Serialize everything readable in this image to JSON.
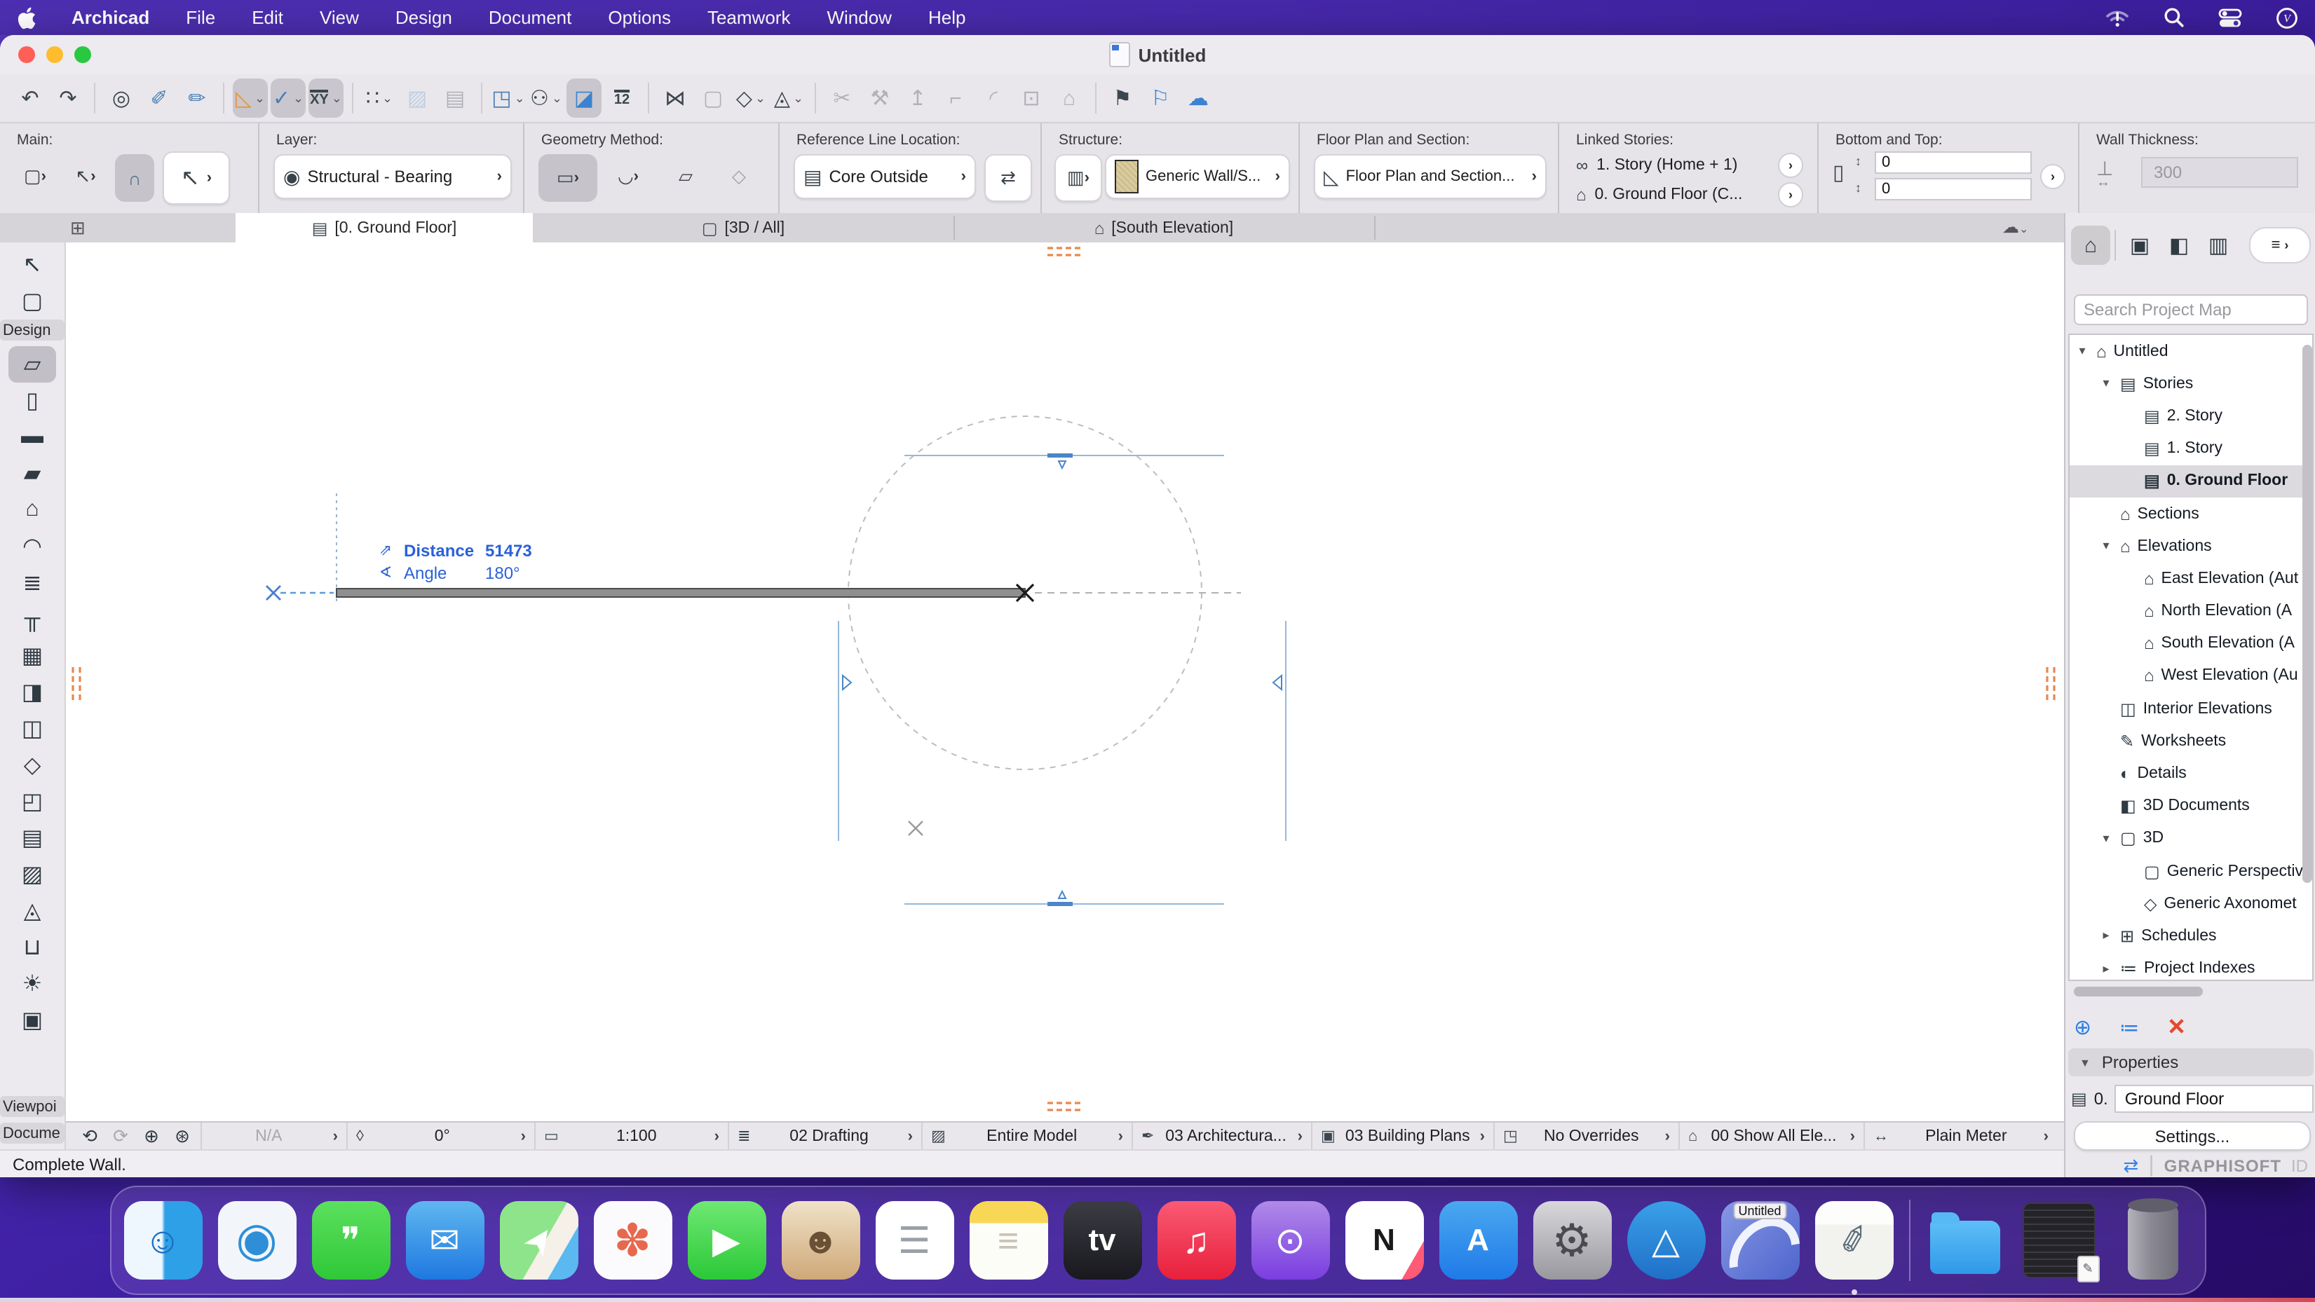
{
  "menu_bar": {
    "app_name": "Archicad",
    "items": [
      "File",
      "Edit",
      "View",
      "Design",
      "Document",
      "Options",
      "Teamwork",
      "Window",
      "Help"
    ],
    "status_icons": [
      "wifi-alert-icon",
      "search-icon",
      "control-center-icon",
      "clock-icon"
    ]
  },
  "window": {
    "title": "Untitled"
  },
  "toolbar": {
    "buttons": [
      {
        "name": "undo-button",
        "glyph": "↶"
      },
      {
        "name": "redo-button",
        "glyph": "↷"
      },
      {
        "divider": true
      },
      {
        "name": "find-select-button",
        "glyph": "◎"
      },
      {
        "name": "pick-up-parameters-button",
        "glyph": "✐",
        "color": "#4a7fb5"
      },
      {
        "name": "inject-parameters-button",
        "glyph": "✏",
        "color": "#4a7fb5"
      },
      {
        "divider": true
      },
      {
        "name": "guide-lines-button",
        "glyph": "◺",
        "pressed": true,
        "chevron": true,
        "color": "#e8943a"
      },
      {
        "name": "snap-guides-button",
        "glyph": "✓",
        "pressed": true,
        "chevron": true,
        "color": "#4a7fb5"
      },
      {
        "name": "tracker-button",
        "glyph": "XY",
        "text": true,
        "pressed": true,
        "chevron": true
      },
      {
        "divider": true
      },
      {
        "name": "grid-snap-button",
        "glyph": "∷",
        "chevron": true
      },
      {
        "name": "skewed-grid-button",
        "glyph": "▨",
        "disabled": true,
        "color": "#6a9ad0"
      },
      {
        "name": "rotated-grid-button",
        "glyph": "▤",
        "disabled": true
      },
      {
        "divider": true
      },
      {
        "name": "trace-reference-button",
        "glyph": "◳",
        "chevron": true,
        "color": "#4a7fb5"
      },
      {
        "name": "virtual-trace-button",
        "glyph": "⚇",
        "chevron": true
      },
      {
        "name": "editing-plane-button",
        "glyph": "◪",
        "pressed": true,
        "color": "#3b82d0"
      },
      {
        "name": "measure-button",
        "glyph": "12",
        "text": true
      },
      {
        "divider": true
      },
      {
        "name": "stretch-button",
        "glyph": "⋈"
      },
      {
        "name": "marquee-selection-button",
        "glyph": "▢",
        "disabled": true
      },
      {
        "name": "3d-cutaway-button",
        "glyph": "◇",
        "chevron": true
      },
      {
        "name": "orient-view-button",
        "glyph": "◬",
        "chevron": true
      },
      {
        "divider": true
      },
      {
        "name": "split-button",
        "glyph": "✂",
        "disabled": true
      },
      {
        "name": "adjust-button",
        "glyph": "⚒",
        "disabled": true
      },
      {
        "name": "align-button",
        "glyph": "↥",
        "disabled": true
      },
      {
        "name": "trim-button",
        "glyph": "⌐",
        "disabled": true
      },
      {
        "name": "fillet-button",
        "glyph": "◜",
        "disabled": true
      },
      {
        "name": "resize-button",
        "glyph": "⊡",
        "disabled": true
      },
      {
        "name": "elevate-button",
        "glyph": "⌂",
        "disabled": true
      },
      {
        "divider": true
      },
      {
        "name": "new-favorite-button",
        "glyph": "⚑"
      },
      {
        "name": "favorites-button",
        "glyph": "⚐",
        "color": "#3b82d0"
      },
      {
        "name": "teamwork-cloud-button",
        "glyph": "☁",
        "color": "#3b82d0"
      }
    ]
  },
  "info_box": {
    "main": {
      "label": "Main:"
    },
    "layer": {
      "label": "Layer:",
      "value": "Structural - Bearing"
    },
    "geometry": {
      "label": "Geometry Method:"
    },
    "ref_line": {
      "label": "Reference Line Location:",
      "value": "Core Outside"
    },
    "structure": {
      "label": "Structure:",
      "value": "Generic Wall/S..."
    },
    "floor_plan": {
      "label": "Floor Plan and Section:",
      "value": "Floor Plan and Section..."
    },
    "linked_stories": {
      "label": "Linked Stories:",
      "top": "1. Story (Home + 1)",
      "bottom": "0. Ground Floor (C..."
    },
    "bottom_top": {
      "label": "Bottom and Top:",
      "top_value": "0",
      "bottom_value": "0"
    },
    "wall_thickness": {
      "label": "Wall Thickness:",
      "value": "300"
    }
  },
  "tabs": [
    {
      "label": "[0. Ground Floor]",
      "active": true
    },
    {
      "label": "[3D / All]",
      "active": false
    },
    {
      "label": "[South Elevation]",
      "active": false
    }
  ],
  "tool_box": {
    "items": [
      {
        "type": "tool",
        "name": "arrow-tool",
        "glyph": "↖"
      },
      {
        "type": "tool",
        "name": "marquee-tool",
        "glyph": "▢"
      },
      {
        "type": "label",
        "name": "design-group-label",
        "text": "Design"
      },
      {
        "type": "tool",
        "name": "wall-tool",
        "glyph": "▱",
        "selected": true
      },
      {
        "type": "tool",
        "name": "column-tool",
        "glyph": "▯"
      },
      {
        "type": "tool",
        "name": "beam-tool",
        "glyph": "▬"
      },
      {
        "type": "tool",
        "name": "slab-tool",
        "glyph": "▰"
      },
      {
        "type": "tool",
        "name": "roof-tool",
        "glyph": "⌂"
      },
      {
        "type": "tool",
        "name": "shell-tool",
        "glyph": "◠"
      },
      {
        "type": "tool",
        "name": "stair-tool",
        "glyph": "≣"
      },
      {
        "type": "tool",
        "name": "railing-tool",
        "glyph": "╥"
      },
      {
        "type": "tool",
        "name": "curtain-wall-tool",
        "glyph": "▦"
      },
      {
        "type": "tool",
        "name": "door-tool",
        "glyph": "◨"
      },
      {
        "type": "tool",
        "name": "window-tool",
        "glyph": "◫"
      },
      {
        "type": "tool",
        "name": "skylight-tool",
        "glyph": "◇"
      },
      {
        "type": "tool",
        "name": "opening-tool",
        "glyph": "◰"
      },
      {
        "type": "tool",
        "name": "zone-tool",
        "glyph": "▤"
      },
      {
        "type": "tool",
        "name": "mesh-tool",
        "glyph": "▨"
      },
      {
        "type": "tool",
        "name": "morph-tool",
        "glyph": "◬"
      },
      {
        "type": "tool",
        "name": "object-tool",
        "glyph": "⊔"
      },
      {
        "type": "tool",
        "name": "lamp-tool",
        "glyph": "☀"
      },
      {
        "type": "tool",
        "name": "equipment-tool",
        "glyph": "▣"
      },
      {
        "type": "label",
        "name": "viewpoint-group-label",
        "text": "Viewpoi"
      },
      {
        "type": "label",
        "name": "document-group-label",
        "text": "Docume"
      }
    ]
  },
  "canvas": {
    "tracker": {
      "distance_label": "Distance",
      "distance_value": "51473",
      "angle_label": "Angle",
      "angle_value": "180°"
    }
  },
  "navigator": {
    "search_placeholder": "Search Project Map",
    "menu_glyph": "≡",
    "tree": [
      {
        "label": "Untitled",
        "level": 0,
        "icon": "⌂",
        "chevron": "down"
      },
      {
        "label": "Stories",
        "level": 1,
        "icon": "▤",
        "chevron": "down"
      },
      {
        "label": "2. Story",
        "level": 2,
        "icon": "▤",
        "chevron": "none"
      },
      {
        "label": "1. Story",
        "level": 2,
        "icon": "▤",
        "chevron": "none"
      },
      {
        "label": "0. Ground Floor",
        "level": 2,
        "icon": "▤",
        "chevron": "none",
        "selected": true,
        "bold": true
      },
      {
        "label": "Sections",
        "level": 1,
        "icon": "⌂",
        "chevron": "none"
      },
      {
        "label": "Elevations",
        "level": 1,
        "icon": "⌂",
        "chevron": "down"
      },
      {
        "label": "East Elevation (Aut",
        "level": 2,
        "icon": "⌂",
        "chevron": "none"
      },
      {
        "label": "North Elevation (A",
        "level": 2,
        "icon": "⌂",
        "chevron": "none"
      },
      {
        "label": "South Elevation (A",
        "level": 2,
        "icon": "⌂",
        "chevron": "none"
      },
      {
        "label": "West Elevation (Au",
        "level": 2,
        "icon": "⌂",
        "chevron": "none"
      },
      {
        "label": "Interior Elevations",
        "level": 1,
        "icon": "◫",
        "chevron": "none"
      },
      {
        "label": "Worksheets",
        "level": 1,
        "icon": "✎",
        "chevron": "none"
      },
      {
        "label": "Details",
        "level": 1,
        "icon": "◐",
        "chevron": "none"
      },
      {
        "label": "3D Documents",
        "level": 1,
        "icon": "◧",
        "chevron": "none"
      },
      {
        "label": "3D",
        "level": 1,
        "icon": "▢",
        "chevron": "down"
      },
      {
        "label": "Generic Perspectiv",
        "level": 2,
        "icon": "▢",
        "chevron": "none"
      },
      {
        "label": "Generic Axonomet",
        "level": 2,
        "icon": "◇",
        "chevron": "none"
      },
      {
        "label": "Schedules",
        "level": 1,
        "icon": "⊞",
        "chevron": "right"
      },
      {
        "label": "Project Indexes",
        "level": 1,
        "icon": "≔",
        "chevron": "right"
      }
    ],
    "properties": {
      "header": "Properties",
      "story_prefix": "0.",
      "story_name": "Ground Floor",
      "settings_label": "Settings..."
    },
    "footer": {
      "brand": "GRAPHISOFT",
      "brand_suffix": "ID"
    }
  },
  "status_bar": {
    "zoom_tools": [
      {
        "name": "zoom-back-button",
        "glyph": "⟲"
      },
      {
        "name": "zoom-forward-button",
        "glyph": "⟳",
        "disabled": true
      },
      {
        "name": "zoom-in-button",
        "glyph": "⊕"
      },
      {
        "name": "fit-in-window-button",
        "glyph": "⊛"
      }
    ],
    "groups": [
      {
        "name": "zoom-value",
        "label": "N/A",
        "glyph": "",
        "w": 104,
        "disabled": true
      },
      {
        "name": "orientation",
        "label": "0°",
        "glyph": "◊",
        "w": 134
      },
      {
        "name": "scale",
        "label": "1:100",
        "glyph": "▭",
        "w": 138
      },
      {
        "name": "layer-combination",
        "label": "02 Drafting",
        "glyph": "≣",
        "w": 138
      },
      {
        "name": "partial-structure-display",
        "label": "Entire Model",
        "glyph": "▨",
        "w": 150
      },
      {
        "name": "pen-set",
        "label": "03 Architectura...",
        "glyph": "✒",
        "w": 128
      },
      {
        "name": "model-view-options",
        "label": "03 Building Plans",
        "glyph": "▣",
        "w": 130
      },
      {
        "name": "graphic-overrides",
        "label": "No Overrides",
        "glyph": "◳",
        "w": 132
      },
      {
        "name": "renovation-filter",
        "label": "00 Show All Ele...",
        "glyph": "⌂",
        "w": 132
      },
      {
        "name": "dimension-style",
        "label": "Plain Meter",
        "glyph": "↔",
        "w": 138
      }
    ]
  },
  "message_bar": "Complete Wall.",
  "dock": {
    "items": [
      {
        "name": "finder-dock-icon",
        "bg": "linear-gradient(90deg,#eef7fd 48%,#2ea0e8 52%)",
        "glyph": "☺",
        "color": "#1d6fc0"
      },
      {
        "name": "safari-dock-icon",
        "bg": "#f2f6fa",
        "glyph": "◉",
        "color": "#2e8fd8",
        "size": 34
      },
      {
        "name": "messages-dock-icon",
        "bg": "linear-gradient(#5ce05e,#2fc838)",
        "glyph": "❞",
        "color": "#fff"
      },
      {
        "name": "mail-dock-icon",
        "bg": "linear-gradient(#5fb7f0,#1f78e0)",
        "glyph": "✉",
        "color": "#fff"
      },
      {
        "name": "maps-dock-icon",
        "bg": "linear-gradient(120deg,#8ee48a 0 55%,#f5f0e8 55% 75%,#5bb8f0 75%)",
        "glyph": "➤",
        "color": "#fff",
        "rot": -55
      },
      {
        "name": "photos-dock-icon",
        "bg": "#fbfbfd",
        "glyph": "✽",
        "color": "#e8684e",
        "size": 32
      },
      {
        "name": "facetime-dock-icon",
        "bg": "linear-gradient(#6ee873,#2cc838)",
        "glyph": "▶",
        "color": "#fff"
      },
      {
        "name": "contacts-dock-icon",
        "bg": "linear-gradient(#f0e2c8,#cfa878)",
        "glyph": "☻",
        "color": "#6a5034"
      },
      {
        "name": "reminders-dock-icon",
        "bg": "#ffffff",
        "glyph": "☰",
        "color": "#9aa0a8"
      },
      {
        "name": "notes-dock-icon",
        "bg": "linear-gradient(180deg,#f8d756 0 28%,#fdfdf8 28%)",
        "glyph": "≡",
        "color": "#c8c4b8"
      },
      {
        "name": "tv-dock-icon",
        "bg": "linear-gradient(#3c3c44,#18181e)",
        "glyph": "tv",
        "color": "#fff",
        "text": true
      },
      {
        "name": "music-dock-icon",
        "bg": "linear-gradient(#fa5a74,#e8203c)",
        "glyph": "♫",
        "color": "#fff"
      },
      {
        "name": "podcasts-dock-icon",
        "bg": "linear-gradient(#b08ae8,#7a3ee0)",
        "glyph": "⊙",
        "color": "#fff"
      },
      {
        "name": "news-dock-icon",
        "bg": "linear-gradient(300deg,#ff5a76 0 18%,#fff 18%)",
        "glyph": "N",
        "color": "#1a1a1a",
        "text": true
      },
      {
        "name": "app-store-dock-icon",
        "bg": "linear-gradient(#4aa8f0,#1f7ae8)",
        "glyph": "A",
        "color": "#fff",
        "text": true
      },
      {
        "name": "system-settings-dock-icon",
        "bg": "linear-gradient(#d8d8dc,#98989e)",
        "glyph": "⚙",
        "color": "#4a4a50",
        "size": 32
      },
      {
        "name": "archicad-dock-icon",
        "bg": "linear-gradient(#3aa0e8,#1f70c8)",
        "glyph": "△",
        "color": "#fff",
        "circle": true
      },
      {
        "name": "archicad-window-dock-icon",
        "shape": "window",
        "label": "Untitled",
        "dot": true
      },
      {
        "name": "textedit-dock-icon",
        "bg": "linear-gradient(180deg,#fdfdfb 0 30%,#f2f2ee 30%)",
        "glyph": "✐",
        "color": "#5a6a78",
        "dot": true,
        "rot": -15
      },
      {
        "sep": true
      },
      {
        "name": "downloads-folder-dock-icon",
        "shape": "folder"
      },
      {
        "name": "minimized-window-dock-icon",
        "shape": "minwin"
      },
      {
        "name": "trash-dock-icon",
        "shape": "trash"
      }
    ]
  },
  "colors": {
    "menubar_purple": "#4c2fb0",
    "accent_blue": "#2a61d8",
    "selection_gray": "#dcdade",
    "wall_fill": "#8f8f8f",
    "guide_orange": "#e8884e",
    "delete_red": "#e8472e",
    "action_blue": "#2f7fe8",
    "structure_swatch_tan": "#d9cb9f"
  }
}
